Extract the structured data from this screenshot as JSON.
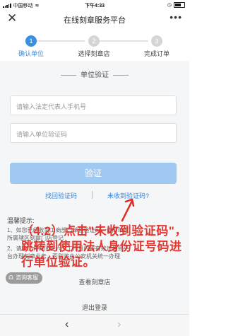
{
  "status_bar": {
    "carrier": "中国移动",
    "time": "下午4:33"
  },
  "nav": {
    "title": "在线刻章服务平台",
    "close_icon": "close-icon",
    "more_icon": "more-icon"
  },
  "steps": [
    {
      "number": "1",
      "label": "确认单位",
      "active": true
    },
    {
      "number": "2",
      "label": "选择刻章店",
      "active": false
    },
    {
      "number": "3",
      "label": "完成订单",
      "active": false
    }
  ],
  "colors": {
    "accent": "#3a8fe0",
    "button_disabled": "#9fc9f1",
    "annotation": "#e4271f"
  },
  "form": {
    "section_title": "单位验证",
    "phone_placeholder": "请输入法定代表人手机号",
    "code_placeholder": "请输入单位验证码",
    "verify_button": "验证",
    "retrieve_link": "找回验证码",
    "not_received_link": "未收到验证码?"
  },
  "tips": {
    "title": "温馨提示:",
    "line1": "1、如您已经收到工商部门单位验证码，请向单位",
    "line2": "所属辖区刻章门店登记",
    "line3": "2、请于工作时间在六个工作日内持有效证件到平",
    "line4": "台办理刻章业务，否则将由公安机关统一办理"
  },
  "view_shops": "查看刻章店",
  "logout": "退出登录",
  "support_badge": "咨询客服",
  "annotation": "（4.2）点击\"未收到验证码\"，跳转到使用法人身份证号码进行单位验证。"
}
